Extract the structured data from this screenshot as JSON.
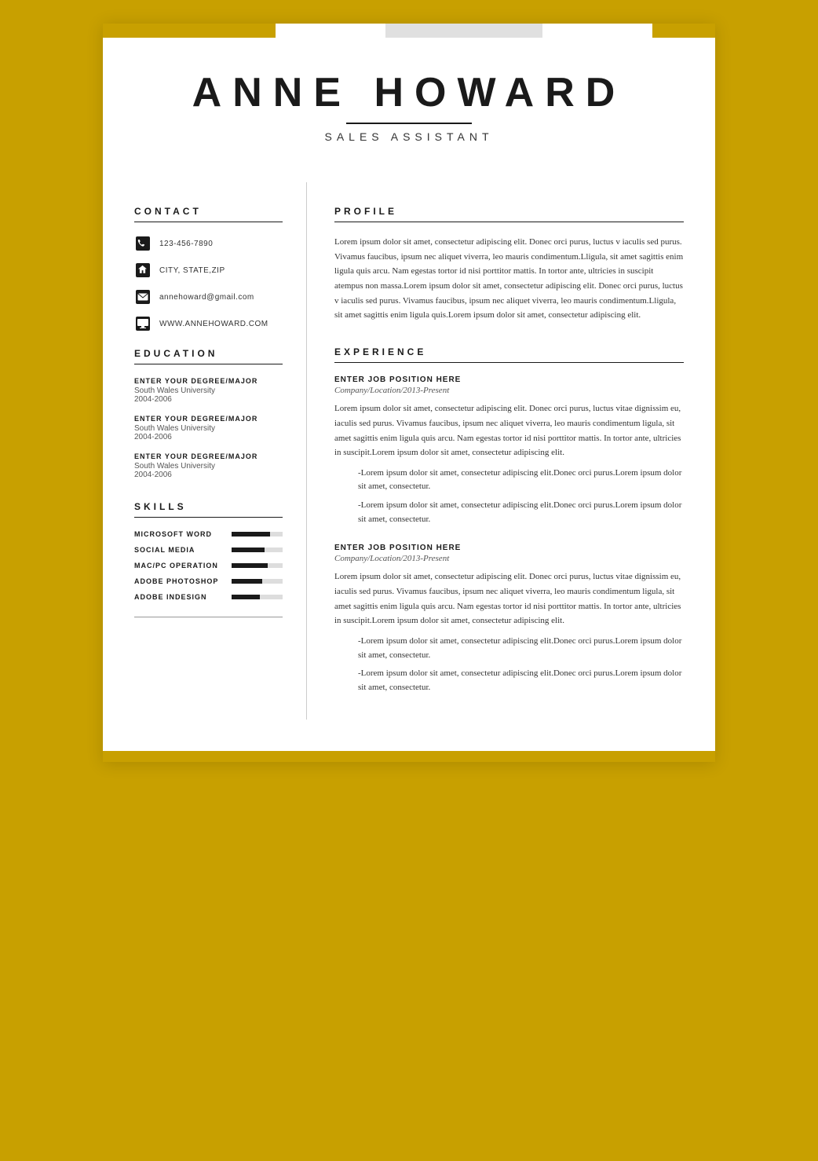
{
  "header": {
    "name": "ANNE HOWARD",
    "title": "SALES ASSISTANT"
  },
  "contact": {
    "section_label": "CONTACT",
    "phone": "123-456-7890",
    "address": "CITY, STATE,ZIP",
    "email": "annehoward@gmail.com",
    "website": "WWW.ANNEHOWARD.COM"
  },
  "education": {
    "section_label": "EDUCATION",
    "entries": [
      {
        "degree": "ENTER YOUR DEGREE/MAJOR",
        "school": "South Wales University",
        "years": "2004-2006"
      },
      {
        "degree": "ENTER YOUR DEGREE/MAJOR",
        "school": "South Wales University",
        "years": "2004-2006"
      },
      {
        "degree": "ENTER YOUR DEGREE/MAJOR",
        "school": "South Wales University",
        "years": "2004-2006"
      }
    ]
  },
  "skills": {
    "section_label": "SKILLS",
    "items": [
      {
        "name": "MICROSOFT WORD",
        "percent": 75
      },
      {
        "name": "SOCIAL MEDIA",
        "percent": 65
      },
      {
        "name": "MAC/PC OPERATION",
        "percent": 70
      },
      {
        "name": "ADOBE PHOTOSHOP",
        "percent": 60
      },
      {
        "name": "ADOBE INDESIGN",
        "percent": 55
      }
    ]
  },
  "profile": {
    "section_label": "PROFILE",
    "text": "Lorem ipsum dolor sit amet, consectetur adipiscing elit. Donec orci purus, luctus v iaculis sed purus. Vivamus faucibus, ipsum nec aliquet viverra, leo mauris condimentum.Lligula, sit amet sagittis enim ligula quis arcu. Nam egestas tortor id nisi porttitor mattis. In tortor ante, ultricies in suscipit atempus non massa.Lorem ipsum dolor sit amet, consectetur adipiscing elit. Donec orci purus, luctus v iaculis sed purus. Vivamus faucibus, ipsum nec aliquet viverra, leo mauris condimentum.Lligula, sit amet sagittis enim ligula quis.Lorem ipsum dolor sit amet, consectetur adipiscing elit."
  },
  "experience": {
    "section_label": "EXPERIENCE",
    "entries": [
      {
        "position": "ENTER JOB POSITION HERE",
        "company": "Company/Location/2013-Present",
        "description": "Lorem ipsum dolor sit amet, consectetur adipiscing elit. Donec orci purus, luctus vitae dignissim eu, iaculis sed purus. Vivamus faucibus, ipsum nec aliquet viverra, leo mauris condimentum ligula, sit amet sagittis enim ligula quis arcu. Nam egestas tortor id nisi porttitor mattis. In tortor ante, ultricies in suscipit.Lorem ipsum dolor sit amet, consectetur adipiscing elit.",
        "bullets": [
          "-Lorem ipsum dolor sit amet, consectetur adipiscing elit.Donec orci purus.Lorem ipsum dolor sit amet, consectetur.",
          "-Lorem ipsum dolor sit amet, consectetur adipiscing elit.Donec orci purus.Lorem ipsum dolor sit amet, consectetur."
        ]
      },
      {
        "position": "ENTER JOB POSITION HERE",
        "company": "Company/Location/2013-Present",
        "description": "Lorem ipsum dolor sit amet, consectetur adipiscing elit. Donec orci purus, luctus vitae dignissim eu, iaculis sed purus. Vivamus faucibus, ipsum nec aliquet viverra, leo mauris condimentum ligula, sit amet sagittis enim ligula quis arcu. Nam egestas tortor id nisi porttitor mattis. In tortor ante, ultricies in suscipit.Lorem ipsum dolor sit amet, consectetur adipiscing elit.",
        "bullets": [
          "-Lorem ipsum dolor sit amet, consectetur adipiscing elit.Donec orci purus.Lorem ipsum dolor sit amet, consectetur.",
          "-Lorem ipsum dolor sit amet, consectetur adipiscing elit.Donec orci purus.Lorem ipsum dolor sit amet, consectetur."
        ]
      }
    ]
  },
  "colors": {
    "accent": "#c8a000",
    "dark": "#1a1a1a",
    "text": "#333333"
  }
}
